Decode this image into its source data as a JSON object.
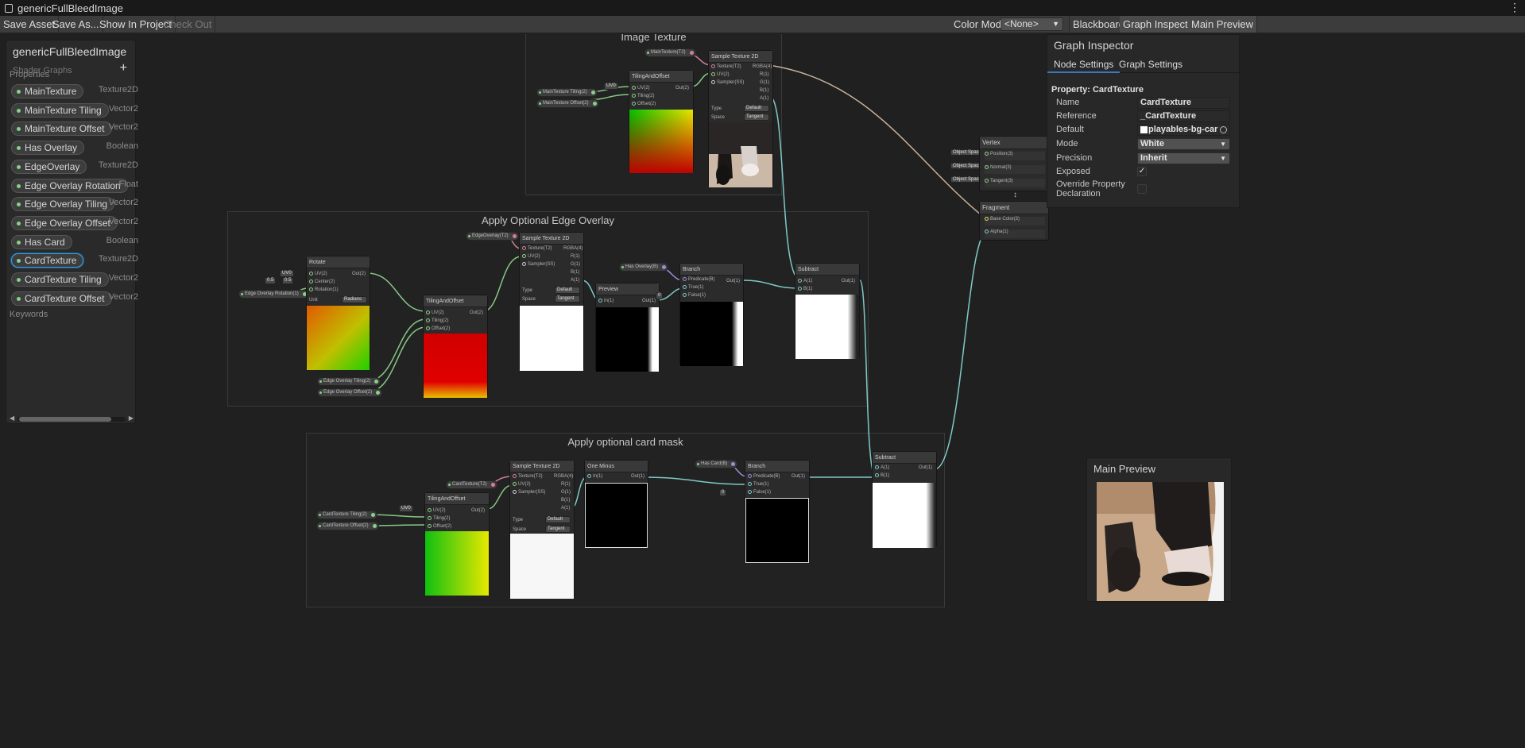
{
  "window": {
    "title": "genericFullBleedImage"
  },
  "toolbar": {
    "save_asset": "Save Asset",
    "save_as": "Save As...",
    "show_in_project": "Show In Project",
    "check_out": "Check Out",
    "color_mode_label": "Color Mode",
    "color_mode_value": "<None>",
    "blackboard": "Blackboard",
    "graph_inspector": "Graph Inspector",
    "main_preview": "Main Preview"
  },
  "blackboard": {
    "title": "genericFullBleedImage",
    "subtitle": "Shader Graphs",
    "add_icon": "+",
    "properties_label": "Properties",
    "keywords_label": "Keywords",
    "properties": [
      {
        "name": "MainTexture",
        "type": "Texture2D"
      },
      {
        "name": "MainTexture Tiling",
        "type": "Vector2"
      },
      {
        "name": "MainTexture Offset",
        "type": "Vector2"
      },
      {
        "name": "Has Overlay",
        "type": "Boolean"
      },
      {
        "name": "EdgeOverlay",
        "type": "Texture2D"
      },
      {
        "name": "Edge Overlay Rotation",
        "type": "Float"
      },
      {
        "name": "Edge Overlay Tiling",
        "type": "Vector2"
      },
      {
        "name": "Edge Overlay Offset",
        "type": "Vector2"
      },
      {
        "name": "Has Card",
        "type": "Boolean"
      },
      {
        "name": "CardTexture",
        "type": "Texture2D"
      },
      {
        "name": "CardTexture Tiling",
        "type": "Vector2"
      },
      {
        "name": "CardTexture Offset",
        "type": "Vector2"
      }
    ],
    "selected_property": "CardTexture"
  },
  "groups": {
    "image_texture": "Image Texture",
    "edge_overlay": "Apply Optional Edge Overlay",
    "card_mask": "Apply optional card mask"
  },
  "nodes": {
    "tiling_and_offset": "TilingAndOffset",
    "sample_texture_2d": "Sample Texture 2D",
    "rotate": "Rotate",
    "preview": "Preview",
    "branch": "Branch",
    "subtract": "Subtract",
    "one_minus": "One Minus",
    "vertex": "Vertex",
    "fragment": "Fragment"
  },
  "ports": {
    "uv": "UV(2)",
    "tiling": "Tiling(2)",
    "offset": "Offset(2)",
    "out2": "Out(2)",
    "texture": "Texture(T2)",
    "sampler": "Sampler(SS)",
    "rgba": "RGBA(4)",
    "r": "R(1)",
    "g": "G(1)",
    "b": "B(1)",
    "a": "A(1)",
    "center": "Center(2)",
    "rotation": "Rotation(1)",
    "unit_label": "Unit",
    "unit_value": "Radians",
    "in": "In(1)",
    "out": "Out(1)",
    "a1": "A(1)",
    "b1": "B(1)",
    "predicate": "Predicate(B)",
    "true": "True(1)",
    "false": "False(1)",
    "type_label": "Type",
    "type_value": "Default",
    "space_label": "Space",
    "space_value": "Tangent",
    "position": "Position(3)",
    "normal": "Normal(3)",
    "tangent": "Tangent(3)",
    "object_space": "Object Space",
    "base_color": "Base Color(3)",
    "alpha": "Alpha(1)",
    "uv0": "UV0",
    "center_x": "0.5",
    "center_y": "0.5",
    "zero": "0"
  },
  "pills": {
    "main_texture": "MainTexture(T2)",
    "main_tiling": "MainTexture Tiling(2)",
    "main_offset": "MainTexture Offset(2)",
    "edge_overlay": "EdgeOverlay(T2)",
    "edge_rotation": "Edge Overlay Rotation(1)",
    "edge_tiling": "Edge Overlay Tiling(2)",
    "edge_offset": "Edge Overlay Offset(2)",
    "has_overlay": "Has Overlay(B)",
    "card_texture": "CardTexture(T2)",
    "card_tiling": "CardTexture Tiling(2)",
    "card_offset": "CardTexture Offset(2)",
    "has_card": "Has Card(B)"
  },
  "inspector": {
    "title": "Graph Inspector",
    "tab_node_settings": "Node Settings",
    "tab_graph_settings": "Graph Settings",
    "property_title": "Property: CardTexture",
    "name_label": "Name",
    "name_value": "CardTexture",
    "reference_label": "Reference",
    "reference_value": "_CardTexture",
    "default_label": "Default",
    "default_value": "playables-bg-car",
    "mode_label": "Mode",
    "mode_value": "White",
    "precision_label": "Precision",
    "precision_value": "Inherit",
    "exposed_label": "Exposed",
    "exposed_checked": true,
    "override_label_1": "Override Property",
    "override_label_2": "Declaration",
    "override_checked": false
  },
  "main_preview": {
    "title": "Main Preview"
  }
}
